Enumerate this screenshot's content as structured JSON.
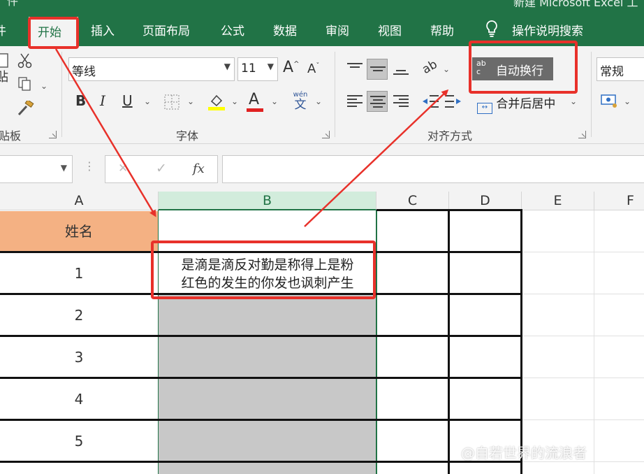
{
  "window": {
    "title_fragment": "新建 Microsoft Excel 工",
    "quick_access_fragment": "件"
  },
  "tabs": [
    {
      "label": "开始",
      "active": true
    },
    {
      "label": "插入"
    },
    {
      "label": "页面布局"
    },
    {
      "label": "公式"
    },
    {
      "label": "数据"
    },
    {
      "label": "审阅"
    },
    {
      "label": "视图"
    },
    {
      "label": "帮助"
    }
  ],
  "tell_me": {
    "label": "操作说明搜索",
    "icon": "lightbulb-icon"
  },
  "ribbon": {
    "clipboard": {
      "label": "贴板",
      "paste_fragment": "贴"
    },
    "font": {
      "label": "字体",
      "font_name": "等线",
      "font_size": "11",
      "increase_size": "A",
      "decrease_size": "A",
      "bold": "B",
      "italic": "I",
      "underline": "U",
      "font_color_glyph": "A",
      "phonetic_top": "wén",
      "phonetic_bottom": "文"
    },
    "alignment": {
      "label": "对齐方式",
      "wrap_text": "自动换行",
      "wrap_icon_top": "ab",
      "wrap_icon_bottom": "c",
      "merge_center": "合并后居中"
    },
    "number": {
      "format": "常规"
    }
  },
  "formula_bar": {
    "cancel_glyph": "✕",
    "enter_glyph": "✓",
    "fx_label": "fx",
    "content": ""
  },
  "sheet": {
    "columns": [
      "A",
      "B",
      "C",
      "D",
      "E",
      "F"
    ],
    "header_cell": "姓名",
    "rows": [
      "1",
      "2",
      "3",
      "4",
      "5"
    ],
    "b2_line1": "是滴是滴反对勤是称得上是粉",
    "b2_line2": "红色的发生的你发也讽刺产生"
  },
  "colors": {
    "excel_green": "#217346",
    "header_fill": "#f4b183",
    "selection_gray": "#c8c8c8",
    "annotation_red": "#e8312a"
  },
  "watermark": "@自若世界的流浪者"
}
